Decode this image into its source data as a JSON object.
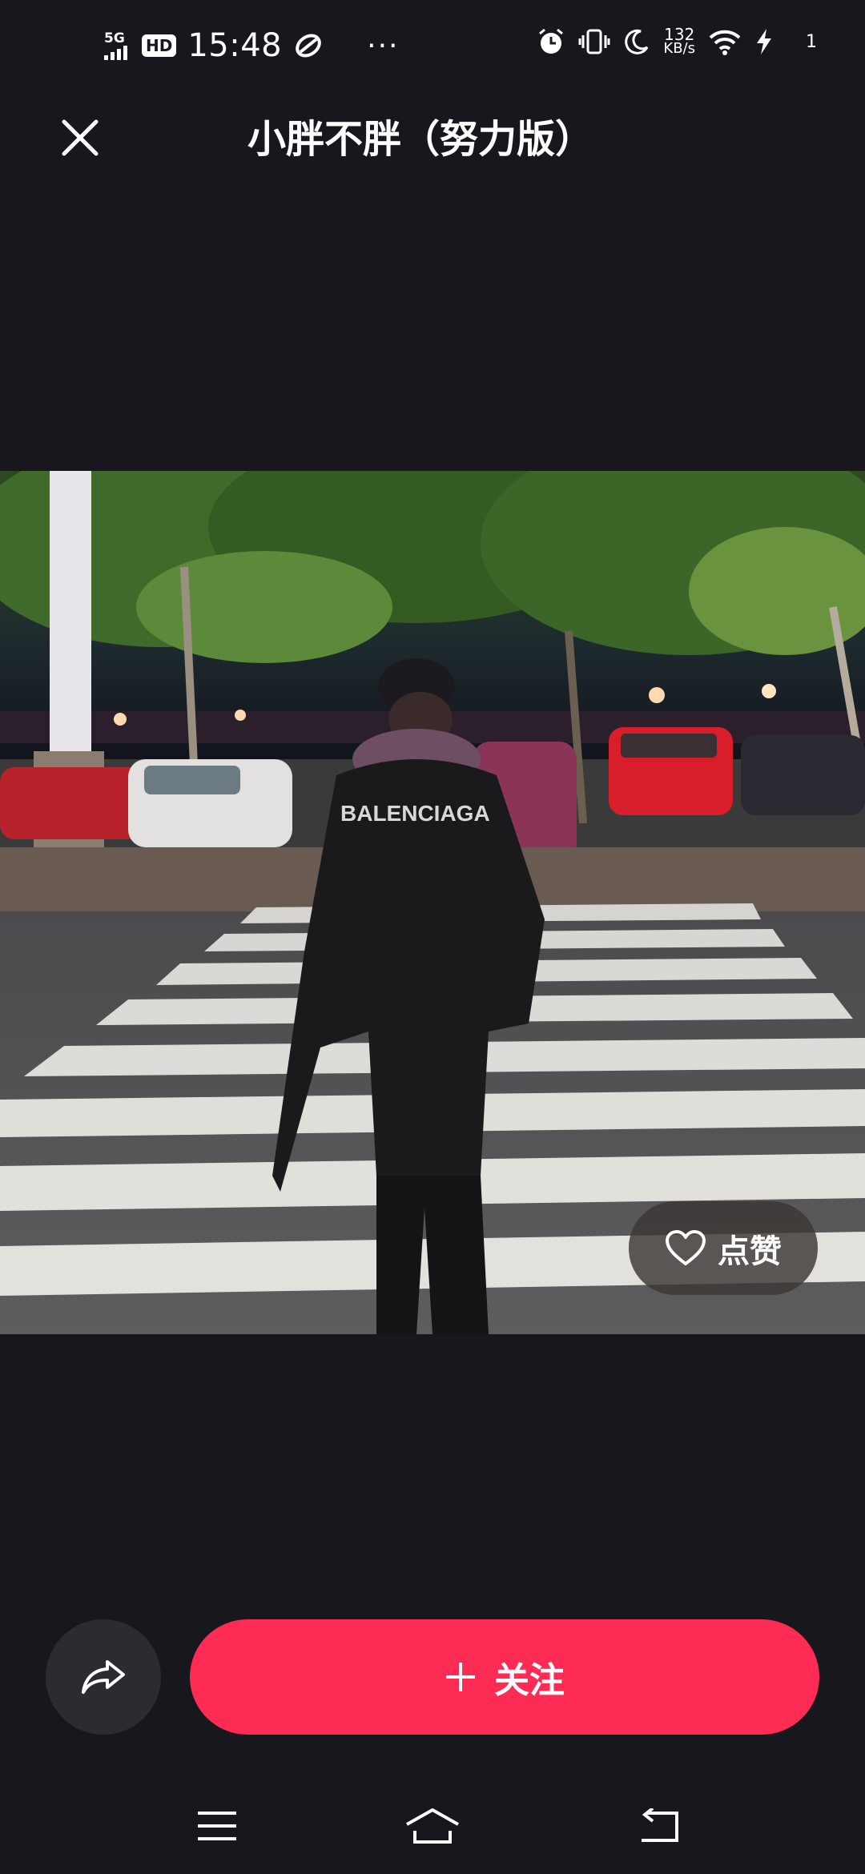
{
  "status_bar": {
    "network": "5G",
    "hd": "HD",
    "time": "15:48",
    "more": "···",
    "speed_value": "132",
    "speed_unit": "KB/s",
    "battery_text": "1"
  },
  "header": {
    "title": "小胖不胖（努力版）",
    "close_icon": "close-icon"
  },
  "photo": {
    "jacket_text": "BALENCIAGA"
  },
  "like_button": {
    "label": "点赞",
    "icon": "heart-outline-icon"
  },
  "actions": {
    "share_icon": "share-arrow-icon",
    "follow_label": "关注",
    "follow_icon": "plus-icon"
  },
  "colors": {
    "background": "#18171d",
    "follow_accent": "#fe2c55",
    "share_bg": "#2c2b31"
  },
  "nav": {
    "menu_icon": "menu-icon",
    "home_icon": "home-icon",
    "back_icon": "back-icon"
  }
}
